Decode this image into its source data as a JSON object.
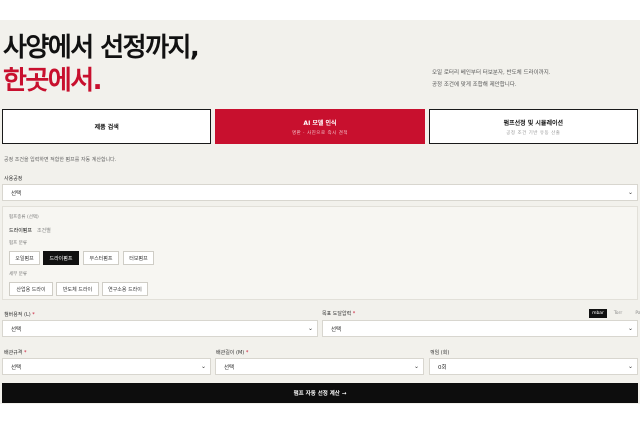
{
  "hero": {
    "title_line1": "사양에서 선정까지,",
    "title_line2": "한곳에서.",
    "subtitle_line1": "오일 로터리 베인부터 터보분자, 반도체 드라이까지.",
    "subtitle_line2": "공정 조건에 맞게 조합해 제안합니다."
  },
  "tabs": [
    {
      "title": "제품 검색",
      "sub": ""
    },
    {
      "title": "AI 모델 인식",
      "sub": "명판 · 사진으로 즉시 견적"
    },
    {
      "title": "펌프선정 및 시뮬레이션",
      "sub": "공정 조건 기반 유동 산출"
    }
  ],
  "hint": "공정 조건을 입력하면 적합한 펌프를 자동 계산합니다.",
  "application": {
    "label": "사용공정",
    "value": "선택"
  },
  "pump_type": {
    "label": "펌프종류 (선택)",
    "sub_active": "드라이펌프",
    "sub_alt": "조건별",
    "group_label": "펌프 분류",
    "chips": [
      "오일펌프",
      "드라이펌프",
      "부스터펌프",
      "터보펌프"
    ],
    "detail_label": "세부 분류",
    "detail_chips": [
      "산업용 드라이",
      "반도체 드라이",
      "연구소용 드라이"
    ]
  },
  "chamber_volume": {
    "label": "챔버용적 (L)",
    "value": "선택"
  },
  "target_pressure": {
    "label": "목표 도달압력",
    "value": "선택"
  },
  "pressure_units": [
    "mbar",
    "Torr",
    "Pa"
  ],
  "pipe_spec": {
    "label": "배관규격",
    "value": "선택"
  },
  "pipe_length": {
    "label": "배관길이 (M)",
    "value": "선택"
  },
  "bends": {
    "label": "꺾임 (회)",
    "value": "0회"
  },
  "required_mark": "*",
  "chevron": "⌄",
  "cta": "펌프 자동 선정 계산 →"
}
